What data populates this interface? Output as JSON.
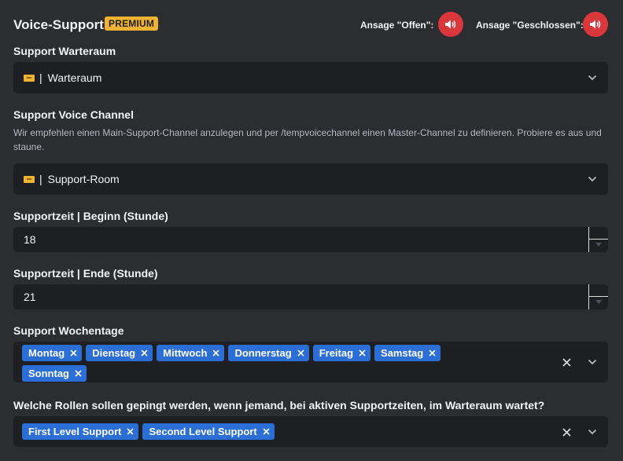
{
  "header": {
    "title": "Voice-Support",
    "badge": "PREMIUM",
    "announce_open_label": "Ansage \"Offen\":",
    "announce_closed_label": "Ansage \"Geschlossen\":"
  },
  "waiting_room": {
    "label": "Support Warteraum",
    "selected_separator": "|",
    "selected": "Warteraum"
  },
  "voice_channel": {
    "label": "Support Voice Channel",
    "description": "Wir empfehlen einen Main-Support-Channel anzulegen und per /tempvoicechannel einen Master-Channel zu definieren. Probiere es aus und staune.",
    "selected_separator": "|",
    "selected": "Support-Room"
  },
  "start_hour": {
    "label": "Supportzeit | Beginn (Stunde)",
    "value": "18"
  },
  "end_hour": {
    "label": "Supportzeit | Ende (Stunde)",
    "value": "21"
  },
  "weekdays": {
    "label": "Support Wochentage",
    "chips": [
      "Montag",
      "Dienstag",
      "Mittwoch",
      "Donnerstag",
      "Freitag",
      "Samstag",
      "Sonntag"
    ]
  },
  "roles": {
    "label": "Welche Rollen sollen gepingt werden, wenn jemand, bei aktiven Supportzeiten, im Warteraum wartet?",
    "chips": [
      "First Level Support",
      "Second Level Support"
    ]
  },
  "colors": {
    "background": "#2b2d31",
    "field": "#1e1f22",
    "chip": "#2b6fd6",
    "badge": "#f0b232",
    "speaker_button": "#da373c"
  },
  "icons": {
    "speaker": "speaker-icon",
    "channel": "channel-icon",
    "chevron": "chevron-down-icon",
    "remove": "close-icon"
  }
}
